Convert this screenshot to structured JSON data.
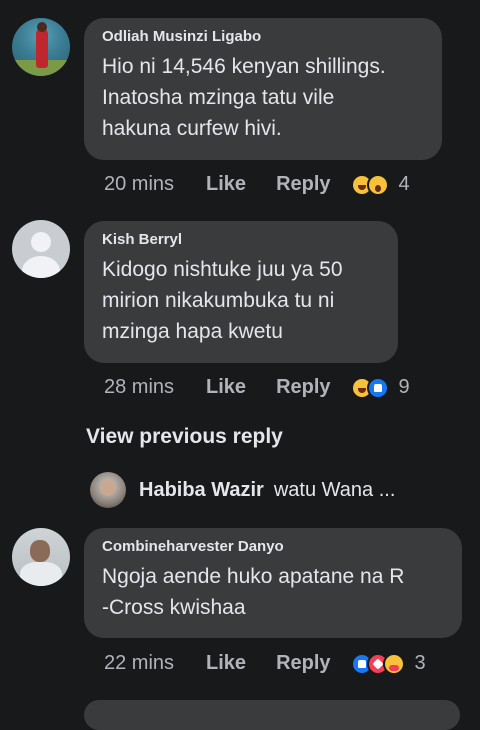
{
  "comments": [
    {
      "author": "Odliah Musinzi Ligabo",
      "text": "Hio ni 14,546 kenyan shillings.\nInatosha mzinga tatu vile\nhakuna curfew hivi.",
      "time": "20 mins",
      "like_label": "Like",
      "reply_label": "Reply",
      "reactions": [
        "haha",
        "wow"
      ],
      "reaction_count": "4"
    },
    {
      "author": "Kish Berryl",
      "text": "Kidogo nishtuke juu ya 50\nmirion nikakumbuka tu ni\nmzinga hapa kwetu",
      "time": "28 mins",
      "like_label": "Like",
      "reply_label": "Reply",
      "reactions": [
        "haha",
        "like"
      ],
      "reaction_count": "9"
    },
    {
      "author": "Combineharvester Danyo",
      "text": "Ngoja aende huko apatane na R\n-Cross kwishaa",
      "time": "22 mins",
      "like_label": "Like",
      "reply_label": "Reply",
      "reactions": [
        "like",
        "love",
        "care"
      ],
      "reaction_count": "3"
    }
  ],
  "view_previous_reply": "View previous reply",
  "reply_preview": {
    "author": "Habiba Wazir",
    "snippet": "watu Wana ..."
  }
}
